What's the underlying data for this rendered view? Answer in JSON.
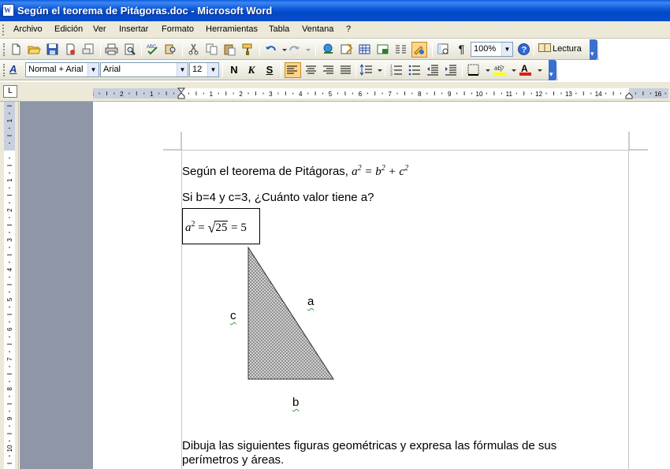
{
  "window": {
    "title": "Según el teorema de Pitágoras.doc - Microsoft Word",
    "app_icon_label": "W"
  },
  "menubar": {
    "items": [
      "Archivo",
      "Edición",
      "Ver",
      "Insertar",
      "Formato",
      "Herramientas",
      "Tabla",
      "Ventana",
      "?"
    ]
  },
  "toolbar_standard": {
    "zoom": "100%",
    "reading_label": "Lectura"
  },
  "toolbar_format": {
    "style": "Normal + Arial",
    "font": "Arial",
    "size": "12",
    "bold_label": "N",
    "italic_label": "K",
    "underline_label": "S"
  },
  "ruler": {
    "corner_symbol": "L",
    "h_labels": [
      "3",
      "2",
      "1",
      "1",
      "2",
      "3",
      "4",
      "5",
      "6",
      "7",
      "8",
      "9",
      "10",
      "11",
      "12",
      "13",
      "14",
      "16"
    ],
    "v_labels": [
      "1",
      "1",
      "2",
      "3",
      "4",
      "5",
      "6",
      "7",
      "8",
      "9",
      "10"
    ]
  },
  "document": {
    "line1_text": "Según el teorema de Pitágoras, ",
    "line1_eq": {
      "a": "a",
      "b": "b",
      "c": "c",
      "exp": "2"
    },
    "line2": "Si b=4 y c=3, ¿Cuánto valor tiene a?",
    "equation": {
      "lhs": "a",
      "exp": "2",
      "radicand": "25",
      "result": "5"
    },
    "triangle_labels": {
      "a": "a",
      "b": "b",
      "c": "c"
    },
    "paragraph": [
      "Dibuja las siguientes figuras geométricas y expresa las fórmulas de sus",
      "perímetros y áreas."
    ]
  },
  "colors": {
    "titlebar": "#0a55d6",
    "chrome": "#ece9d8",
    "gray_area": "#8e96a8",
    "active_button": "#ffd58a"
  }
}
